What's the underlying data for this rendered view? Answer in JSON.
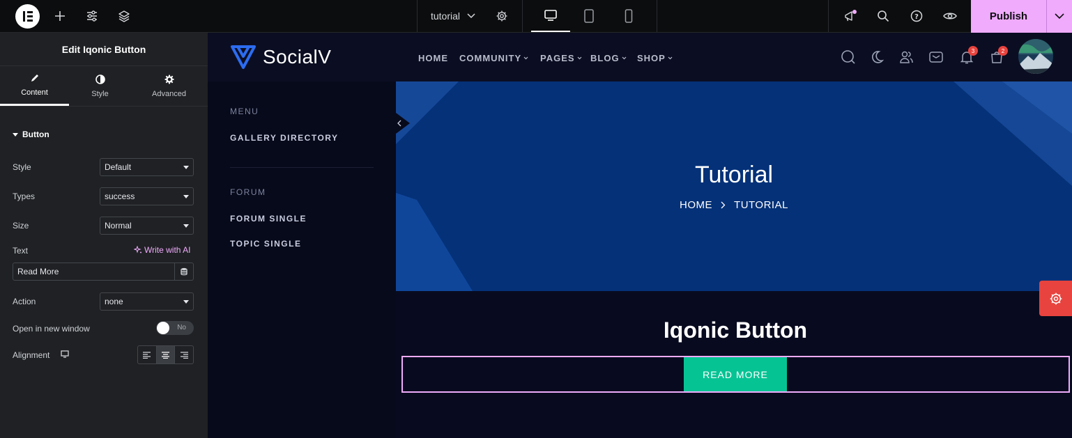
{
  "topbar": {
    "page_name": "tutorial",
    "publish_label": "Publish"
  },
  "panel": {
    "title": "Edit Iqonic Button",
    "tabs": [
      {
        "label": "Content",
        "icon": "pencil-icon"
      },
      {
        "label": "Style",
        "icon": "half-circle-icon"
      },
      {
        "label": "Advanced",
        "icon": "gear-icon"
      }
    ],
    "section_title": "Button",
    "fields": {
      "style": {
        "label": "Style",
        "value": "Default"
      },
      "types": {
        "label": "Types",
        "value": "success"
      },
      "size": {
        "label": "Size",
        "value": "Normal"
      },
      "text": {
        "label": "Text",
        "value": "Read More",
        "ai_label": "Write with AI"
      },
      "action": {
        "label": "Action",
        "value": "none"
      },
      "new_window": {
        "label": "Open in new window",
        "toggle_text": "No"
      },
      "alignment": {
        "label": "Alignment"
      }
    }
  },
  "site": {
    "logo_text": "SocialV",
    "nav": [
      "HOME",
      "COMMUNITY",
      "PAGES",
      "BLOG",
      "SHOP"
    ],
    "notifications_count": "3",
    "cart_count": "2",
    "sidebar": {
      "menu_heading": "MENU",
      "menu_items": [
        "GALLERY DIRECTORY"
      ],
      "forum_heading": "FORUM",
      "forum_items": [
        "FORUM SINGLE",
        "TOPIC SINGLE"
      ]
    },
    "hero": {
      "title": "Tutorial",
      "breadcrumb_home": "HOME",
      "breadcrumb_current": "TUTORIAL"
    },
    "content": {
      "heading": "Iqonic Button",
      "button_label": "READ MORE"
    }
  },
  "colors": {
    "accent_pink": "#f0abfc",
    "button_green": "#06c394",
    "hero_blue": "#043178",
    "badge_red": "#e8433e"
  }
}
